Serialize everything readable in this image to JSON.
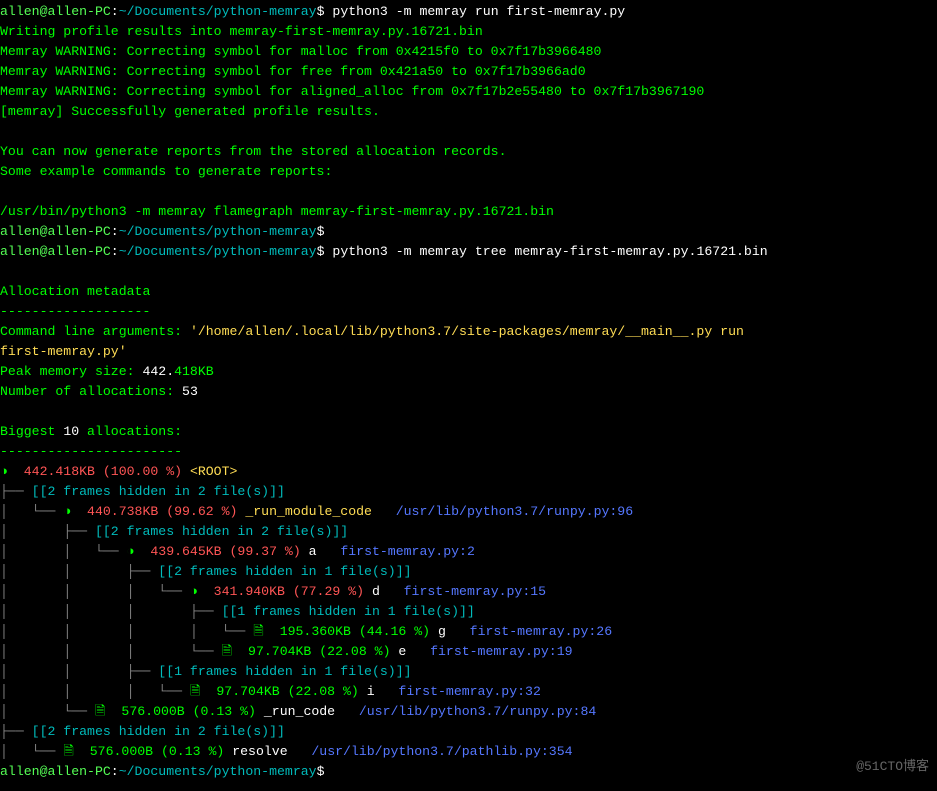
{
  "prompt": {
    "user_host": "allen@allen-PC",
    "colon": ":",
    "path": "~/Documents/python-memray",
    "dollar": "$"
  },
  "cmd1": " python3 -m memray run first-memray.py",
  "out1_l1": "Writing profile results into memray-first-memray.py.16721.bin",
  "out1_l2": "Memray WARNING: Correcting symbol for malloc from 0x4215f0 to 0x7f17b3966480",
  "out1_l3": "Memray WARNING: Correcting symbol for free from 0x421a50 to 0x7f17b3966ad0",
  "out1_l4": "Memray WARNING: Correcting symbol for aligned_alloc from 0x7f17b2e55480 to 0x7f17b3967190",
  "out1_l5": "[memray] Successfully generated profile results.",
  "out1_l6": "You can now generate reports from the stored allocation records.",
  "out1_l7": "Some example commands to generate reports:",
  "out1_l8": "/usr/bin/python3 -m memray flamegraph memray-first-memray.py.16721.bin",
  "cmd2_empty": "",
  "cmd3": " python3 -m memray tree memray-first-memray.py.16721.bin",
  "meta_hdr": "Allocation metadata",
  "meta_sep": "-------------------",
  "cli_label": "Command line arguments: ",
  "cli_val1": "'/home/allen/.local/lib/python3.7/site-packages/memray/__main__.py run ",
  "cli_val2": "first-memray.py'",
  "peak_label": "Peak memory size: ",
  "peak_num": "442.",
  "peak_rest": "418KB",
  "alloc_label": "Number of allocations: ",
  "alloc_num": "53",
  "big_l1a": "Biggest ",
  "big_l1b": "10",
  "big_l1c": " allocations:",
  "big_sep": "-----------------------",
  "tree": {
    "r0_icon": "◑ ",
    "r0_sz": " 442.418KB (100.00 %) ",
    "r0_root": "<ROOT>",
    "h2_2": "[[2 frames hidden in 2 file(s)]]",
    "h2_1": "[[2 frames hidden in 1 file(s)]]",
    "h1_1": "[[1 frames hidden in 1 file(s)]]",
    "r1_sz": " 440.738KB (99.62 %) ",
    "r1_fn": "_run_module_code",
    "r1_loc": "/usr/lib/python3.7/runpy.py:96",
    "r2_sz": " 439.645KB (99.37 %) ",
    "r2_fn": "a",
    "r2_loc": "first-memray.py:2",
    "r3_sz": " 341.940KB (77.29 %) ",
    "r3_fn": "d",
    "r3_loc": "first-memray.py:15",
    "r4_sz": " 195.360KB (44.16 %) ",
    "r4_fn": "g",
    "r4_loc": "first-memray.py:26",
    "r5_sz": " 97.704KB (22.08 %) ",
    "r5_fn": "e",
    "r5_loc": "first-memray.py:19",
    "r6_sz": " 97.704KB (22.08 %) ",
    "r6_fn": "i",
    "r6_loc": "first-memray.py:32",
    "r7_sz": " 576.000B (0.13 %) ",
    "r7_fn": "_run_code",
    "r7_loc": "/usr/lib/python3.7/runpy.py:84",
    "r8_sz": " 576.000B (0.13 %) ",
    "r8_fn": "resolve",
    "r8_loc": "/usr/lib/python3.7/pathlib.py:354",
    "box_l": "├── ",
    "box_ll": "└── ",
    "pipe": "│   ",
    "sp": "    ",
    "doc": "🗎 "
  },
  "watermark": "@51CTO博客"
}
